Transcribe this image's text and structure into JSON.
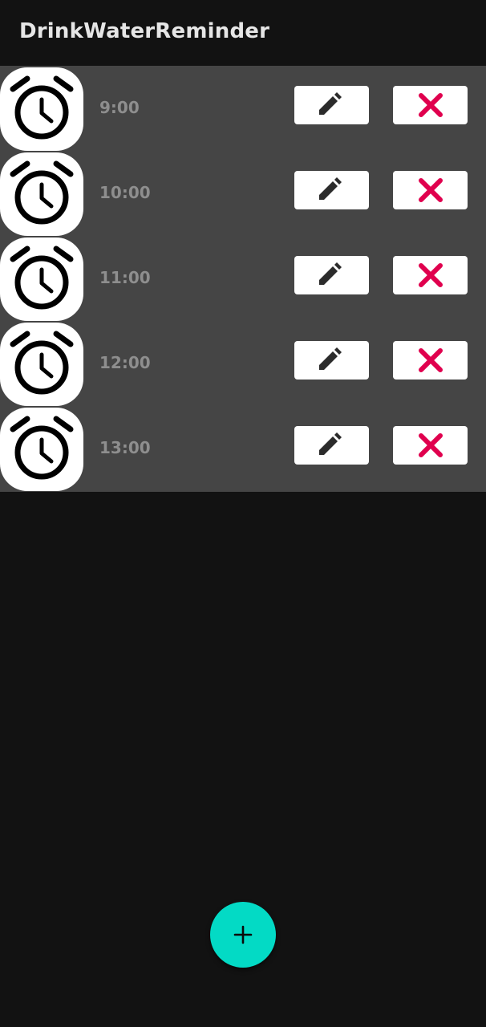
{
  "app": {
    "title": "DrinkWaterReminder"
  },
  "reminders": [
    {
      "time": "9:00"
    },
    {
      "time": "10:00"
    },
    {
      "time": "11:00"
    },
    {
      "time": "12:00"
    },
    {
      "time": "13:00"
    }
  ],
  "icons": {
    "reminder": "alarm-clock-icon",
    "edit": "pencil-icon",
    "delete": "close-x-icon",
    "add": "plus-icon"
  },
  "colors": {
    "background": "#121212",
    "list_background": "#454545",
    "time_text": "#8e8e8e",
    "delete_accent": "#e0004e",
    "fab": "#03dac5"
  }
}
